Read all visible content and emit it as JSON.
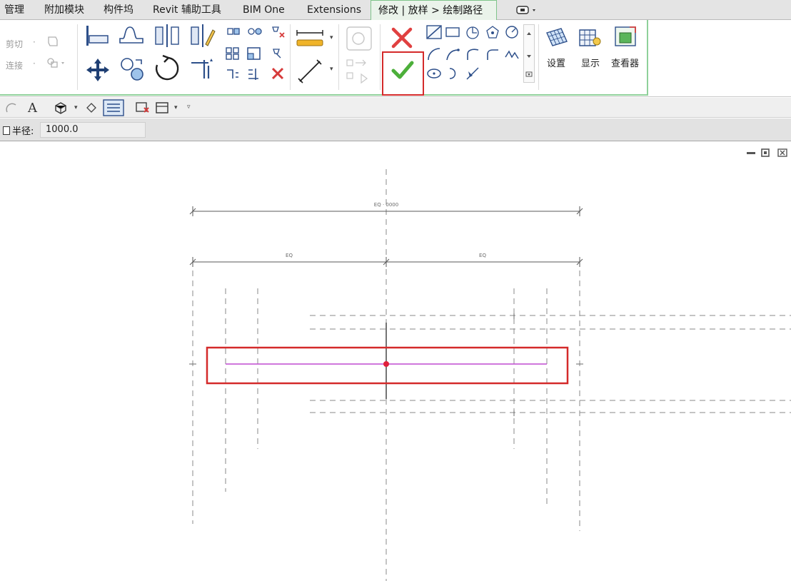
{
  "tabs": [
    {
      "label": "管理"
    },
    {
      "label": "附加模块"
    },
    {
      "label": "构件坞"
    },
    {
      "label": "Revit 辅助工具"
    },
    {
      "label": "BIM One"
    },
    {
      "label": "Extensions"
    },
    {
      "label": "修改 | 放样 > 绘制路径",
      "active": true
    }
  ],
  "ribbon": {
    "modify_panel": {
      "cut_label": "剪切",
      "join_label": "连接"
    },
    "mode_panel": {
      "cancel": "cancel-edit-mode",
      "finish": "finish-edit-mode"
    },
    "workplane_panel": {
      "set_label": "设置",
      "show_label": "显示",
      "viewer_label": "查看器"
    }
  },
  "options_bar": {
    "radius_label": "半径:",
    "radius_value": "1000.0"
  },
  "drawing": {
    "overall_dim": "EQ · 0000",
    "left_dim": "EQ",
    "right_dim": "EQ",
    "path_color": "#c04ad0",
    "highlight_color": "#d42a2a"
  },
  "colors": {
    "accent_green": "#8fd09a",
    "finish_green": "#4caf3a",
    "cancel_red": "#e04040"
  }
}
